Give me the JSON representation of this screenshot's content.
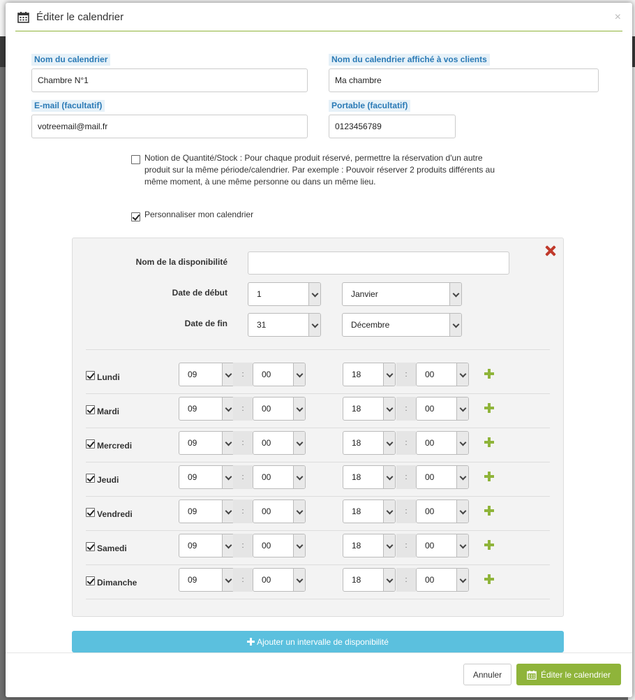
{
  "modal": {
    "title": "Éditer le calendrier",
    "close": "×"
  },
  "fields": {
    "calendar_name": {
      "label": "Nom du calendrier",
      "value": "Chambre N°1"
    },
    "client_name": {
      "label": "Nom du calendrier affiché à vos clients",
      "value": "Ma chambre"
    },
    "email": {
      "label": "E-mail (facultatif)",
      "value": "votreemail@mail.fr"
    },
    "mobile": {
      "label": "Portable (facultatif)",
      "value": "0123456789"
    }
  },
  "options": {
    "stock": {
      "checked": false,
      "text_1": "Notion de Quantité/Stock : Pour chaque produit réservé, permettre la réservation d'un autre",
      "text_2": "produit sur la même période/calendrier. Par exemple : Pouvoir réserver 2 produits différents au",
      "text_3": "même moment, à une même personne ou dans un même lieu."
    },
    "customize": {
      "checked": true,
      "text": "Personnaliser mon calendrier"
    }
  },
  "availability": {
    "name_label": "Nom de la disponibilité",
    "name_value": "",
    "start_label": "Date de début",
    "start_day": "1",
    "start_month": "Janvier",
    "end_label": "Date de fin",
    "end_day": "31",
    "end_month": "Décembre",
    "separator": ":",
    "days": [
      {
        "label": "Lundi",
        "checked": true,
        "from_h": "09",
        "from_m": "00",
        "to_h": "18",
        "to_m": "00"
      },
      {
        "label": "Mardi",
        "checked": true,
        "from_h": "09",
        "from_m": "00",
        "to_h": "18",
        "to_m": "00"
      },
      {
        "label": "Mercredi",
        "checked": true,
        "from_h": "09",
        "from_m": "00",
        "to_h": "18",
        "to_m": "00"
      },
      {
        "label": "Jeudi",
        "checked": true,
        "from_h": "09",
        "from_m": "00",
        "to_h": "18",
        "to_m": "00"
      },
      {
        "label": "Vendredi",
        "checked": true,
        "from_h": "09",
        "from_m": "00",
        "to_h": "18",
        "to_m": "00"
      },
      {
        "label": "Samedi",
        "checked": true,
        "from_h": "09",
        "from_m": "00",
        "to_h": "18",
        "to_m": "00"
      },
      {
        "label": "Dimanche",
        "checked": true,
        "from_h": "09",
        "from_m": "00",
        "to_h": "18",
        "to_m": "00"
      }
    ]
  },
  "actions": {
    "add_interval": "Ajouter un intervalle de disponibilité",
    "cancel": "Annuler",
    "save": "Éditer le calendrier"
  },
  "colors": {
    "accent": "#8fb43a",
    "info": "#5bc0de",
    "label_text": "#2a7ab6",
    "danger": "#c0392b"
  }
}
